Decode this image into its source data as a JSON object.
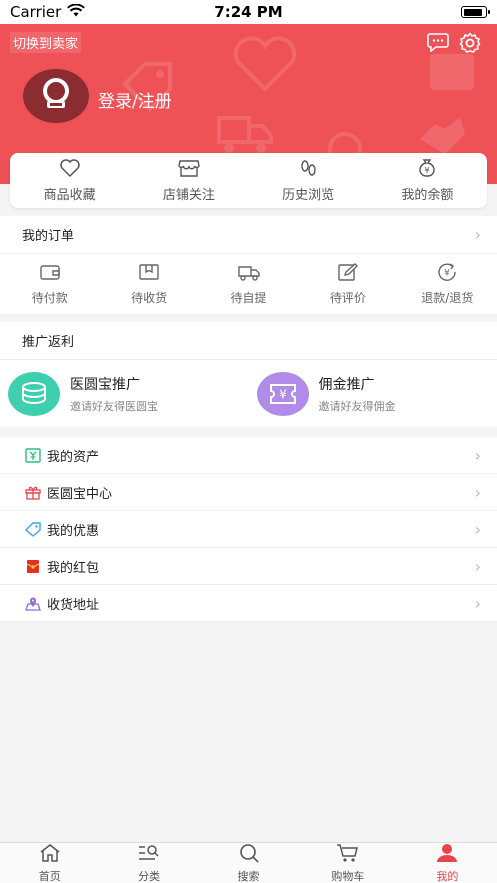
{
  "status_bar": {
    "carrier": "Carrier",
    "time": "7:24 PM",
    "battery_level": 0.9
  },
  "header": {
    "switch_seller": "切换到卖家",
    "login_text": "登录/注册"
  },
  "stats": [
    {
      "label": "商品收藏",
      "icon": "heart-icon"
    },
    {
      "label": "店铺关注",
      "icon": "store-icon"
    },
    {
      "label": "历史浏览",
      "icon": "footprint-icon"
    },
    {
      "label": "我的余额",
      "icon": "money-bag-icon"
    }
  ],
  "orders": {
    "title": "我的订单",
    "items": [
      {
        "label": "待付款",
        "icon": "wallet-icon"
      },
      {
        "label": "待收货",
        "icon": "package-icon"
      },
      {
        "label": "待自提",
        "icon": "truck-icon"
      },
      {
        "label": "待评价",
        "icon": "edit-icon"
      },
      {
        "label": "退款/退货",
        "icon": "refund-icon"
      }
    ]
  },
  "promotion": {
    "title": "推广返利",
    "items": [
      {
        "title": "医圆宝推广",
        "subtitle": "邀请好友得医圆宝",
        "color": "#3ecfae",
        "icon": "coins-icon"
      },
      {
        "title": "佣金推广",
        "subtitle": "邀请好友得佣金",
        "color": "#b08be8",
        "icon": "ticket-icon"
      }
    ]
  },
  "menu": [
    {
      "label": "我的资产",
      "icon": "assets-icon",
      "color": "#2fbf7f"
    },
    {
      "label": "医圆宝中心",
      "icon": "gift-icon",
      "color": "#e8434a"
    },
    {
      "label": "我的优惠",
      "icon": "tag-icon",
      "color": "#3aa7e6"
    },
    {
      "label": "我的红包",
      "icon": "red-envelope-icon",
      "color": "#e8301f"
    },
    {
      "label": "收货地址",
      "icon": "address-icon",
      "color": "#8c6bd6"
    }
  ],
  "tabs": [
    {
      "label": "首页",
      "icon": "home-icon"
    },
    {
      "label": "分类",
      "icon": "category-icon"
    },
    {
      "label": "搜索",
      "icon": "search-icon"
    },
    {
      "label": "购物车",
      "icon": "cart-icon"
    },
    {
      "label": "我的",
      "icon": "profile-icon",
      "active": true
    }
  ],
  "colors": {
    "brand": "#ee5156",
    "active_tab": "#e8434a"
  }
}
